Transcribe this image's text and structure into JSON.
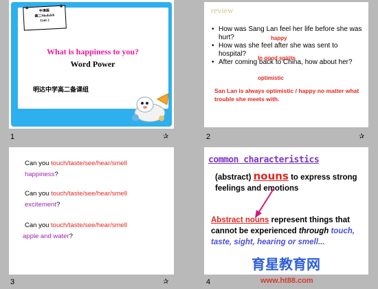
{
  "slides": [
    {
      "number": "1",
      "tag_lines": [
        "牛津版",
        "高二Module6",
        "Unit 2"
      ],
      "title": "What is happiness to you?",
      "subtitle": "Word Power",
      "school": "明达中学高二备课组"
    },
    {
      "number": "2",
      "heading": "review",
      "bullets": [
        "How was Sang Lan feel her life before she was hurt?",
        "How was she feel after she was sent to hospital?",
        "After coming back to China, how about her?"
      ],
      "answers": [
        "happy",
        "In good spirits",
        "optimistic"
      ],
      "conclusion": "San Lan is always optimistic / happy no matter what trouble she meets with."
    },
    {
      "number": "3",
      "lines": [
        {
          "prefix": "Can you ",
          "verbs": "touch/taste/see/hear/smell",
          "object": "happiness",
          "suffix": "?"
        },
        {
          "prefix": "Can you ",
          "verbs": "touch/taste/see/hear/smell",
          "object": "excitement",
          "suffix": "?"
        },
        {
          "prefix": "Can you ",
          "verbs": "touch/taste/see/hear/smell",
          "object": "apple and water",
          "suffix": "?"
        }
      ]
    },
    {
      "number": "4",
      "heading": "common characteristics",
      "p1_prefix": "(abstract) ",
      "p1_nouns": "nouns",
      "p1_suffix": " to express strong feelings and emotions",
      "p2_abs": "Abstract nouns",
      "p2_mid": " represent things that cannot be experienced ",
      "p2_through": "through",
      "p2_senses": " touch, taste, sight, hearing or smell",
      "p2_end": "..."
    }
  ],
  "watermark": {
    "text": "育星教育网",
    "url": "www.ht88.com"
  },
  "colors": {
    "red": "#e0261f",
    "purple": "#7b35c8",
    "blue": "#4a4fd6",
    "pink": "#e8199a",
    "frame_blue": "#2fb0ee"
  }
}
